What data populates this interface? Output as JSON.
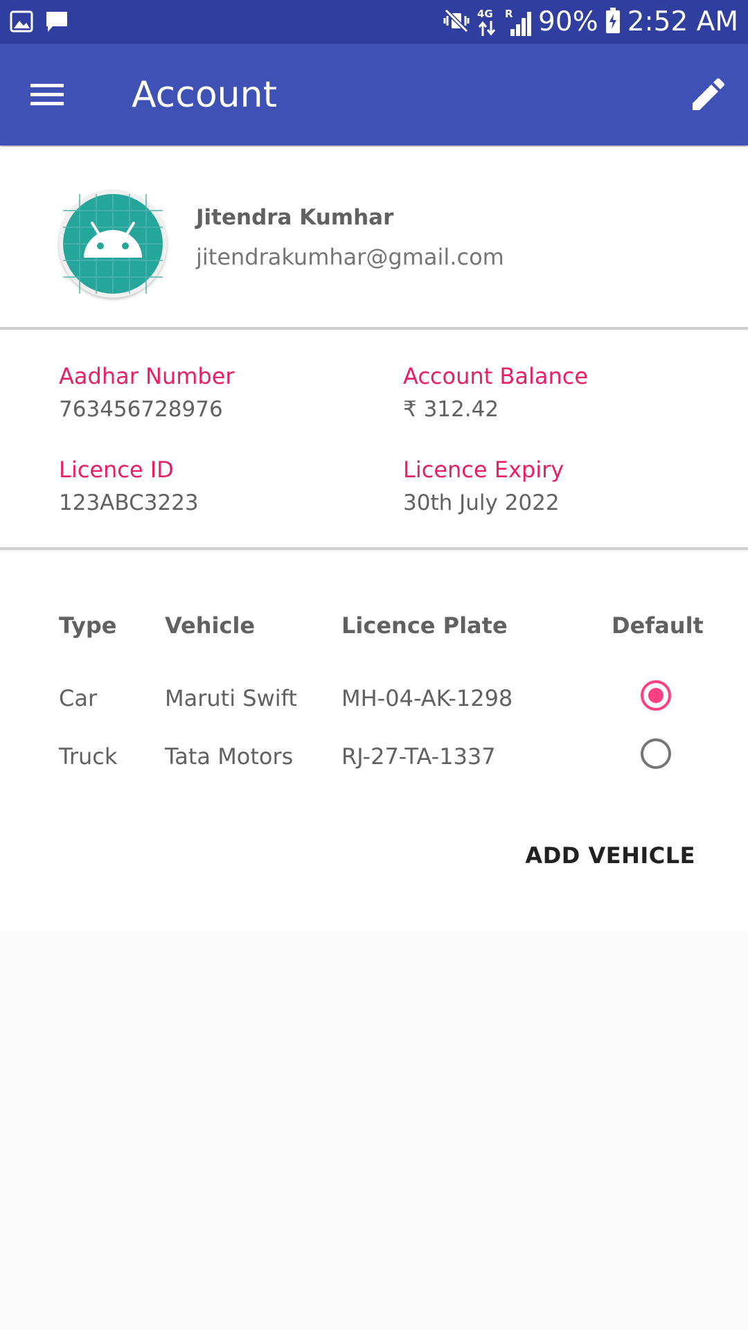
{
  "status_bar": {
    "battery": "90%",
    "time": "2:52 AM",
    "network": "4G",
    "roaming": "R",
    "icons": [
      "image-icon",
      "message-icon",
      "mute-vibrate-icon",
      "data-arrows-icon",
      "signal-icon",
      "battery-charging-icon"
    ]
  },
  "app_bar": {
    "title": "Account",
    "color": "#3f51b5",
    "status_color": "#303f9f",
    "icons": [
      "menu-icon",
      "edit-icon"
    ]
  },
  "profile": {
    "name": "Jitendra Kumhar",
    "email": "jitendrakumhar@gmail.com",
    "avatar_icon": "android-icon"
  },
  "details": {
    "aadhar_label": "Aadhar Number",
    "aadhar_value": "763456728976",
    "balance_label": "Account Balance",
    "balance_value": "₹ 312.42",
    "licence_id_label": "Licence ID",
    "licence_id_value": "123ABC3223",
    "licence_expiry_label": "Licence Expiry",
    "licence_expiry_value": "30th July 2022",
    "accent": "#e91e63"
  },
  "vehicles": {
    "headers": [
      "Type",
      "Vehicle",
      "Licence Plate",
      "Default"
    ],
    "rows": [
      {
        "type": "Car",
        "vehicle": "Maruti Swift",
        "plate": "MH-04-AK-1298",
        "default": true
      },
      {
        "type": "Truck",
        "vehicle": "Tata Motors",
        "plate": "RJ-27-TA-1337",
        "default": false
      }
    ],
    "add_label": "ADD VEHICLE",
    "radio_color": "#ff4081"
  }
}
